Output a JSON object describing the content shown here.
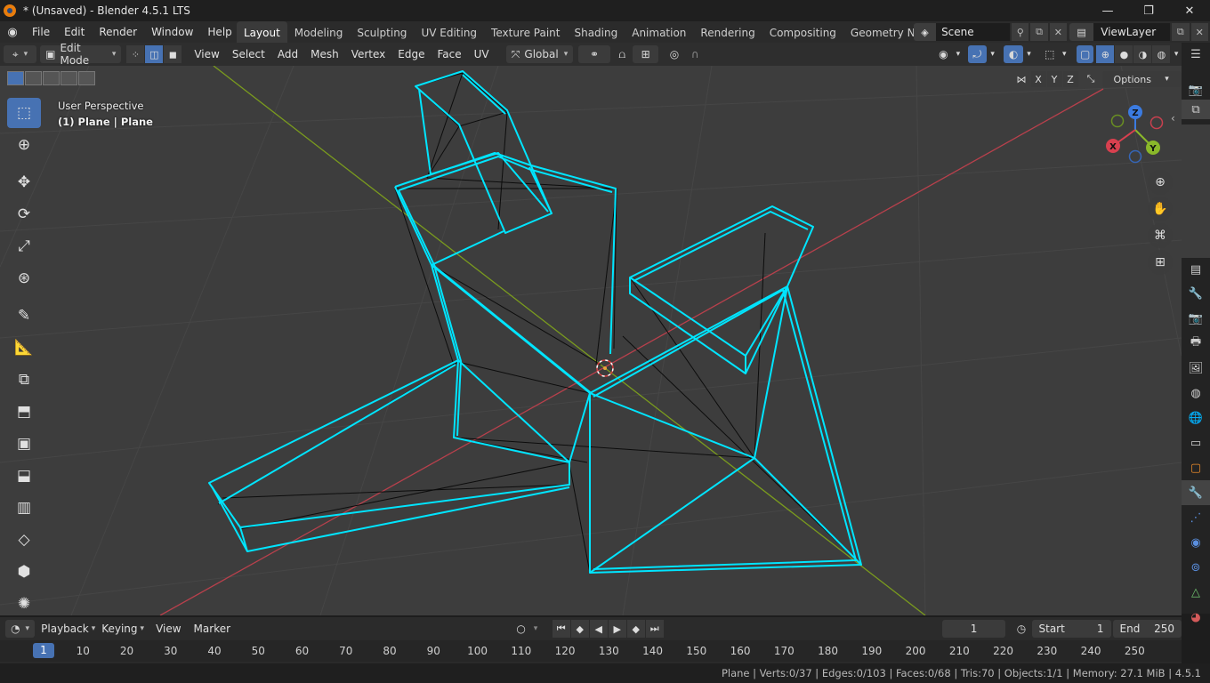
{
  "window": {
    "title": "* (Unsaved) - Blender 4.5.1 LTS",
    "minimize": "—",
    "maximize": "❐",
    "close": "✕"
  },
  "menubar": {
    "items": [
      "File",
      "Edit",
      "Render",
      "Window",
      "Help"
    ],
    "workspaces": [
      "Layout",
      "Modeling",
      "Sculpting",
      "UV Editing",
      "Texture Paint",
      "Shading",
      "Animation",
      "Rendering",
      "Compositing",
      "Geometry Nod"
    ],
    "active_workspace": "Layout",
    "scene": "Scene",
    "view_layer": "ViewLayer"
  },
  "viewport_header": {
    "mode": "Edit Mode",
    "menus": [
      "View",
      "Select",
      "Add",
      "Mesh",
      "Vertex",
      "Edge",
      "Face",
      "UV"
    ],
    "transform_orientation": "Global",
    "options_label": "Options",
    "axes": [
      "X",
      "Y",
      "Z"
    ]
  },
  "viewport": {
    "perspective": "User Perspective",
    "object_info": "(1) Plane | Plane",
    "gizmo_axes": {
      "x": "X",
      "y": "Y",
      "z": "Z"
    },
    "colors": {
      "background": "#3d3d3d",
      "wire_selected": "#00e5ff",
      "x_axis": "#c83c4a",
      "y_axis": "#7a9b1e"
    }
  },
  "timeline": {
    "menus": [
      "Playback",
      "Keying",
      "View",
      "Marker"
    ],
    "current_frame": "1",
    "start_label": "Start",
    "start": "1",
    "end_label": "End",
    "end": "250",
    "ruler_current": "1",
    "ticks": [
      "10",
      "20",
      "30",
      "40",
      "50",
      "60",
      "70",
      "80",
      "90",
      "100",
      "110",
      "120",
      "130",
      "140",
      "150",
      "160",
      "170",
      "180",
      "190",
      "200",
      "210",
      "220",
      "230",
      "240",
      "250"
    ]
  },
  "statusbar": {
    "stats": "Plane | Verts:0/37 | Edges:0/103 | Faces:0/68 | Tris:70 | Objects:1/1 | Memory: 27.1 MiB | 4.5.1"
  }
}
